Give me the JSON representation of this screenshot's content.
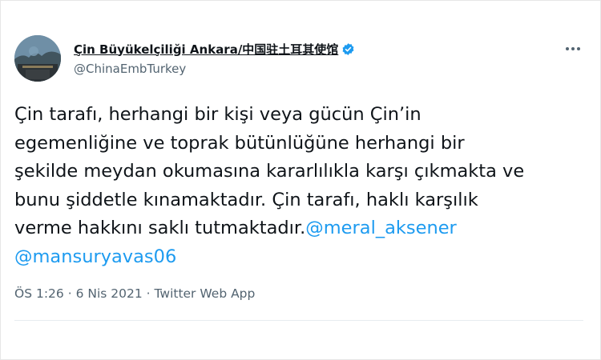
{
  "tweet": {
    "display_name": "Çin Büyükelçiliği Ankara/中国驻土耳其使馆",
    "handle": "@ChinaEmbTurkey",
    "verified": true,
    "more_icon": "more-horizontal-icon",
    "text_lines": [
      "Çin tarafı, herhangi bir kişi veya gücün Çin’in",
      "egemenliğine ve toprak bütünlüğüne herhangi bir",
      "şekilde meydan okumasına kararlılıkla karşı çıkmakta ve",
      "bunu şiddetle kınamaktadır. Çin tarafı, haklı karşılık",
      "verme hakkını saklı tutmaktadır."
    ],
    "mention_1": "@meral_aksener",
    "mention_2": "@mansuryavas06",
    "time": "ÖS 1:26",
    "separator_1": " · ",
    "date": "6 Nis 2021",
    "separator_2": " · ",
    "source": "Twitter Web App"
  },
  "colors": {
    "text": "#0f1419",
    "secondary": "#536471",
    "accent": "#1d9bf0"
  }
}
